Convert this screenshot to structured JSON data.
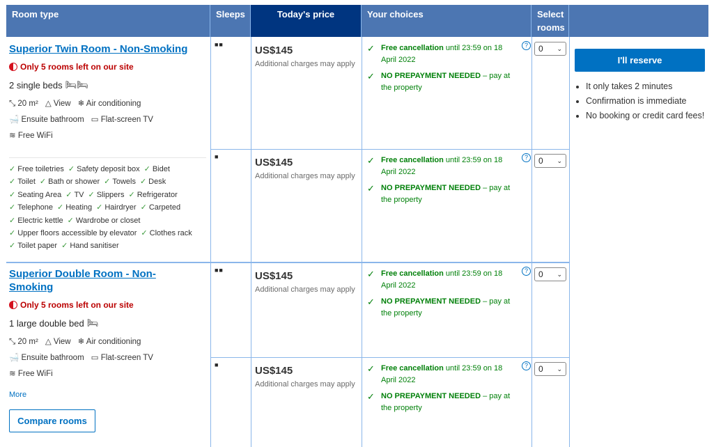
{
  "header": {
    "room_type": "Room type",
    "sleeps": "Sleeps",
    "price": "Today's price",
    "choices": "Your choices",
    "select": "Select rooms"
  },
  "rooms": [
    {
      "name": "Superior Twin Room - Non-Smoking",
      "scarcity": "Only 5 rooms left on our site",
      "beds": "2 single beds",
      "bed_icon": "🛏🛏",
      "facilities": [
        "20 m²",
        "View",
        "Air conditioning",
        "Ensuite bathroom",
        "Flat-screen TV",
        "Free WiFi"
      ],
      "amenities": [
        [
          "Free toiletries",
          "Safety deposit box",
          "Bidet"
        ],
        [
          "Toilet",
          "Bath or shower",
          "Towels",
          "Desk"
        ],
        [
          "Seating Area",
          "TV",
          "Slippers",
          "Refrigerator"
        ],
        [
          "Telephone",
          "Heating",
          "Hairdryer",
          "Carpeted"
        ],
        [
          "Electric kettle",
          "Wardrobe or closet"
        ],
        [
          "Upper floors accessible by elevator",
          "Clothes rack"
        ],
        [
          "Toilet paper",
          "Hand sanitiser"
        ]
      ],
      "options": [
        {
          "sleeps": 2,
          "price": "US$145",
          "additional": "Additional charges may apply",
          "cancel_bold": "Free cancellation",
          "cancel_rest": " until 23:59 on 18 April 2022",
          "prepay_bold": "NO PREPAYMENT NEEDED",
          "prepay_rest": " – pay at the property",
          "selected": "0"
        },
        {
          "sleeps": 1,
          "price": "US$145",
          "additional": "Additional charges may apply",
          "cancel_bold": "Free cancellation",
          "cancel_rest": " until 23:59 on 18 April 2022",
          "prepay_bold": "NO PREPAYMENT NEEDED",
          "prepay_rest": " – pay at the property",
          "selected": "0"
        }
      ]
    },
    {
      "name": "Superior Double Room - Non-Smoking",
      "scarcity": "Only 5 rooms left on our site",
      "beds": "1 large double bed",
      "bed_icon": "🛏",
      "facilities": [
        "20 m²",
        "View",
        "Air conditioning",
        "Ensuite bathroom",
        "Flat-screen TV",
        "Free WiFi"
      ],
      "more": "More",
      "compare": "Compare rooms",
      "options": [
        {
          "sleeps": 2,
          "price": "US$145",
          "additional": "Additional charges may apply",
          "cancel_bold": "Free cancellation",
          "cancel_rest": " until 23:59 on 18 April 2022",
          "prepay_bold": "NO PREPAYMENT NEEDED",
          "prepay_rest": " – pay at the property",
          "selected": "0"
        },
        {
          "sleeps": 1,
          "price": "US$145",
          "additional": "Additional charges may apply",
          "cancel_bold": "Free cancellation",
          "cancel_rest": " until 23:59 on 18 April 2022",
          "prepay_bold": "NO PREPAYMENT NEEDED",
          "prepay_rest": " – pay at the property",
          "selected": "0"
        }
      ]
    }
  ],
  "reserve": {
    "button": "I'll reserve",
    "bullets": [
      "It only takes 2 minutes",
      "Confirmation is immediate",
      "No booking or credit card fees!"
    ]
  },
  "colors": {
    "header": "#4c76b2",
    "header_dark": "#003580",
    "link": "#0071c2",
    "green": "#008009",
    "scarcity": "#b00000"
  }
}
